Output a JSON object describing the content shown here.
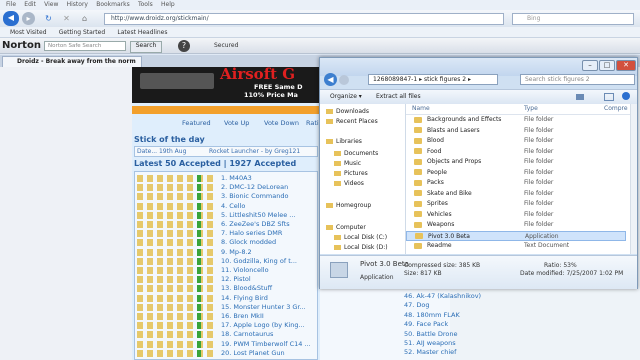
{
  "menu": [
    "File",
    "Edit",
    "View",
    "History",
    "Bookmarks",
    "Tools",
    "Help"
  ],
  "url": "http://www.droidz.org/stickmain/",
  "search_placeholder": "Bing",
  "bookmarks": [
    "Most Visited",
    "Getting Started",
    "Latest Headlines"
  ],
  "norton": {
    "logo": "Norton",
    "search_placeholder": "Norton Safe Search",
    "search_btn": "Search",
    "help": "?",
    "browse": "Secured"
  },
  "tab": {
    "title": "Droidz - Break away from the norm"
  },
  "banner": {
    "title": "Airsoft G",
    "line1": "FREE Same D",
    "line2": "110% Price Ma"
  },
  "subtabs": {
    "featured": "Featured",
    "voteup": "Vote Up",
    "votedown": "Vote Down",
    "ratings": "Ratings"
  },
  "sotd": {
    "heading": "Stick of the day",
    "a": "Date...  19th Aug",
    "b": "Rocket Launcher - by Greg121"
  },
  "latest_heading": "Latest 50 Accepted | 1927 Accepted",
  "list": [
    "1. M40A3",
    "2. DMC-12 DeLorean",
    "3. Bionic Commando",
    "4. Cello",
    "5. Littleshit50 Melee ...",
    "6. ZeeZee's DBZ Sfts",
    "7. Halo series DMR",
    "8. Glock modded",
    "9. Mp-8.2",
    "10. Godzilla, King of t...",
    "11. Violoncello",
    "12. Pistol",
    "13. Blood&Stuff",
    "14. Flying Bird",
    "15. Monster Hunter 3 Gr...",
    "16. Bren MkII",
    "17. Apple Logo (by King...",
    "18. Carnotaurus",
    "19. PWM Timberwolf C14 ...",
    "20. Lost Planet Gun"
  ],
  "list2": [
    "46. Ak-47 (Kalashnikov)",
    "47. Dog",
    "48. 180mm FLAK",
    "49. Face Pack",
    "50. Battle Drone",
    "51. AIJ weapons",
    "52. Master chief"
  ],
  "explorer": {
    "address": "1268089847-1 ▸ stick figures 2 ▸",
    "search_placeholder": "Search stick figures 2",
    "toolbar": {
      "organize": "Organize ▾",
      "extract": "Extract all files"
    },
    "nav": [
      "Downloads",
      "Recent Places",
      "Libraries",
      "Documents",
      "Music",
      "Pictures",
      "Videos",
      "Homegroup",
      "Computer",
      "Local Disk (C:)",
      "Local Disk (D:)"
    ],
    "columns": {
      "name": "Name",
      "type": "Type",
      "comp": "Compre"
    },
    "files": [
      {
        "name": "Backgrounds and Effects",
        "type": "File folder"
      },
      {
        "name": "Blasts and Lasers",
        "type": "File folder"
      },
      {
        "name": "Blood",
        "type": "File folder"
      },
      {
        "name": "Food",
        "type": "File folder"
      },
      {
        "name": "Objects and Props",
        "type": "File folder"
      },
      {
        "name": "People",
        "type": "File folder"
      },
      {
        "name": "Packs",
        "type": "File folder"
      },
      {
        "name": "Skate and Bike",
        "type": "File folder"
      },
      {
        "name": "Sprites",
        "type": "File folder"
      },
      {
        "name": "Vehicles",
        "type": "File folder"
      },
      {
        "name": "Weapons",
        "type": "File folder"
      },
      {
        "name": "Pivot 3.0 Beta",
        "type": "Application"
      },
      {
        "name": "Readme",
        "type": "Text Document"
      }
    ],
    "details": {
      "name": "Pivot 3.0 Beta",
      "kind": "Application",
      "compressed": "Compressed size: 385 KB",
      "size": "Size: 817 KB",
      "ratio": "Ratio: 53%",
      "modified": "Date modified: 7/25/2007 1:02 PM"
    }
  }
}
